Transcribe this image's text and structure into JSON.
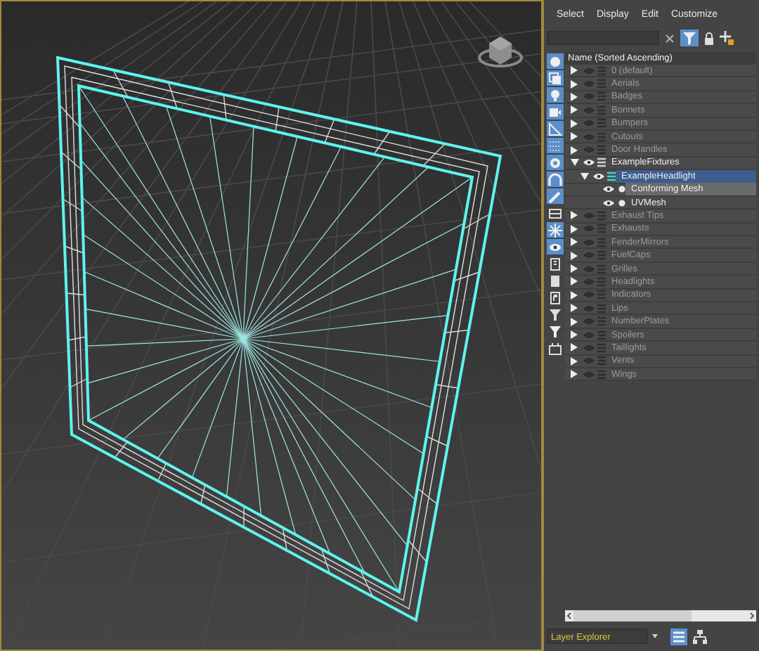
{
  "menu": [
    {
      "label": "Select"
    },
    {
      "label": "Display"
    },
    {
      "label": "Edit"
    },
    {
      "label": "Customize"
    }
  ],
  "toolbar": {
    "filter_on": true
  },
  "tools": [
    {
      "selected": true
    },
    {
      "selected": true
    },
    {
      "selected": true
    },
    {
      "selected": true
    },
    {
      "selected": true
    },
    {
      "selected": true
    },
    {
      "selected": true
    },
    {
      "selected": true
    },
    {
      "selected": true
    },
    {
      "selected": false
    },
    {
      "selected": true
    },
    {
      "selected": true
    },
    {
      "selected": false
    },
    {
      "selected": false
    },
    {
      "selected": false
    },
    {
      "selected": false
    },
    {
      "selected": false
    },
    {
      "selected": false
    }
  ],
  "column_header": "Name (Sorted Ascending)",
  "layers": [
    {
      "kind": "layer",
      "name": "0 (default)",
      "visible": false,
      "expanded": false,
      "selected": false
    },
    {
      "kind": "layer",
      "name": "Aerials",
      "visible": false,
      "expanded": false,
      "selected": false
    },
    {
      "kind": "layer",
      "name": "Badges",
      "visible": false,
      "expanded": false,
      "selected": false
    },
    {
      "kind": "layer",
      "name": "Bonnets",
      "visible": false,
      "expanded": false,
      "selected": false
    },
    {
      "kind": "layer",
      "name": "Bumpers",
      "visible": false,
      "expanded": false,
      "selected": false
    },
    {
      "kind": "layer",
      "name": "Cutouts",
      "visible": false,
      "expanded": false,
      "selected": false
    },
    {
      "kind": "layer",
      "name": "Door Handles",
      "visible": false,
      "expanded": false,
      "selected": false
    },
    {
      "kind": "layer",
      "name": "ExampleFixtures",
      "visible": true,
      "expanded": true,
      "selected": false,
      "children": [
        {
          "kind": "layer",
          "name": "ExampleHeadlight",
          "visible": true,
          "expanded": true,
          "selected": true,
          "children": [
            {
              "kind": "object",
              "name": "Conforming Mesh",
              "visible": true,
              "selected": false,
              "highlighted": true
            },
            {
              "kind": "object",
              "name": "UVMesh",
              "visible": true,
              "selected": false,
              "highlighted": false
            }
          ]
        }
      ]
    },
    {
      "kind": "layer",
      "name": "Exhaust Tips",
      "visible": false,
      "expanded": false,
      "selected": false
    },
    {
      "kind": "layer",
      "name": "Exhausts",
      "visible": false,
      "expanded": false,
      "selected": false
    },
    {
      "kind": "layer",
      "name": "FenderMirrors",
      "visible": false,
      "expanded": false,
      "selected": false
    },
    {
      "kind": "layer",
      "name": "FuelCaps",
      "visible": false,
      "expanded": false,
      "selected": false
    },
    {
      "kind": "layer",
      "name": "Grilles",
      "visible": false,
      "expanded": false,
      "selected": false
    },
    {
      "kind": "layer",
      "name": "Headlights",
      "visible": false,
      "expanded": false,
      "selected": false
    },
    {
      "kind": "layer",
      "name": "Indicators",
      "visible": false,
      "expanded": false,
      "selected": false
    },
    {
      "kind": "layer",
      "name": "Lips",
      "visible": false,
      "expanded": false,
      "selected": false
    },
    {
      "kind": "layer",
      "name": "NumberPlates",
      "visible": false,
      "expanded": false,
      "selected": false
    },
    {
      "kind": "layer",
      "name": "Spoilers",
      "visible": false,
      "expanded": false,
      "selected": false
    },
    {
      "kind": "layer",
      "name": "Taillights",
      "visible": false,
      "expanded": false,
      "selected": false
    },
    {
      "kind": "layer",
      "name": "Vents",
      "visible": false,
      "expanded": false,
      "selected": false
    },
    {
      "kind": "layer",
      "name": "Wings",
      "visible": false,
      "expanded": false,
      "selected": false
    }
  ],
  "explorer": {
    "value": "Layer Explorer"
  },
  "view_buttons": [
    {
      "selected": true
    },
    {
      "selected": false
    }
  ]
}
